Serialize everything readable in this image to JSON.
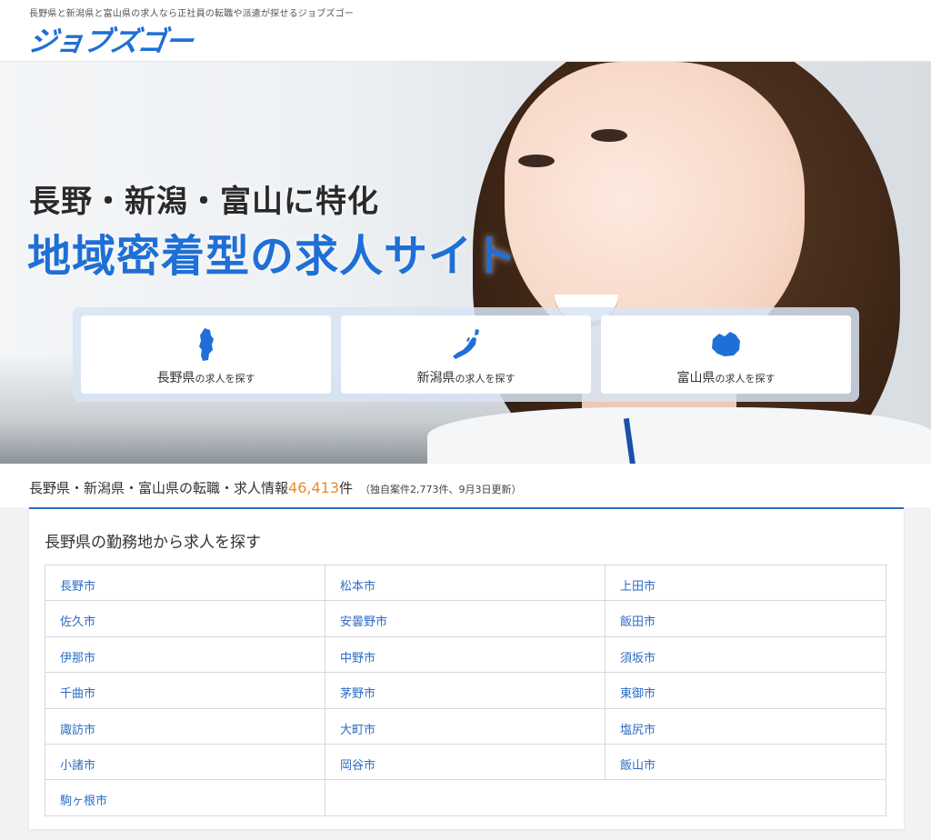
{
  "header": {
    "tagline": "長野県と新潟県と富山県の求人なら正社員の転職や派遣が探せるジョブズゴー",
    "logo": "ジョブズゴー"
  },
  "hero": {
    "subtitle": "長野・新潟・富山に特化",
    "title": "地域密着型の求人サイト"
  },
  "prefectures": [
    {
      "name": "長野県",
      "suffix": "の求人を探す",
      "icon": "nagano-map-icon"
    },
    {
      "name": "新潟県",
      "suffix": "の求人を探す",
      "icon": "niigata-map-icon"
    },
    {
      "name": "富山県",
      "suffix": "の求人を探す",
      "icon": "toyama-map-icon"
    }
  ],
  "stats": {
    "prefix": "長野県・新潟県・富山県の転職・求人情報",
    "count": "46,413",
    "unit": "件",
    "note": "（独自案件2,773件、9月3日更新）"
  },
  "area": {
    "title": "長野県の勤務地から求人を探す",
    "cities": [
      "長野市",
      "松本市",
      "上田市",
      "佐久市",
      "安曇野市",
      "飯田市",
      "伊那市",
      "中野市",
      "須坂市",
      "千曲市",
      "茅野市",
      "東御市",
      "諏訪市",
      "大町市",
      "塩尻市",
      "小諸市",
      "岡谷市",
      "飯山市",
      "駒ヶ根市"
    ]
  },
  "colors": {
    "brand": "#1f6fd6",
    "accent_count": "#f08a24",
    "link": "#2d6cc4"
  }
}
